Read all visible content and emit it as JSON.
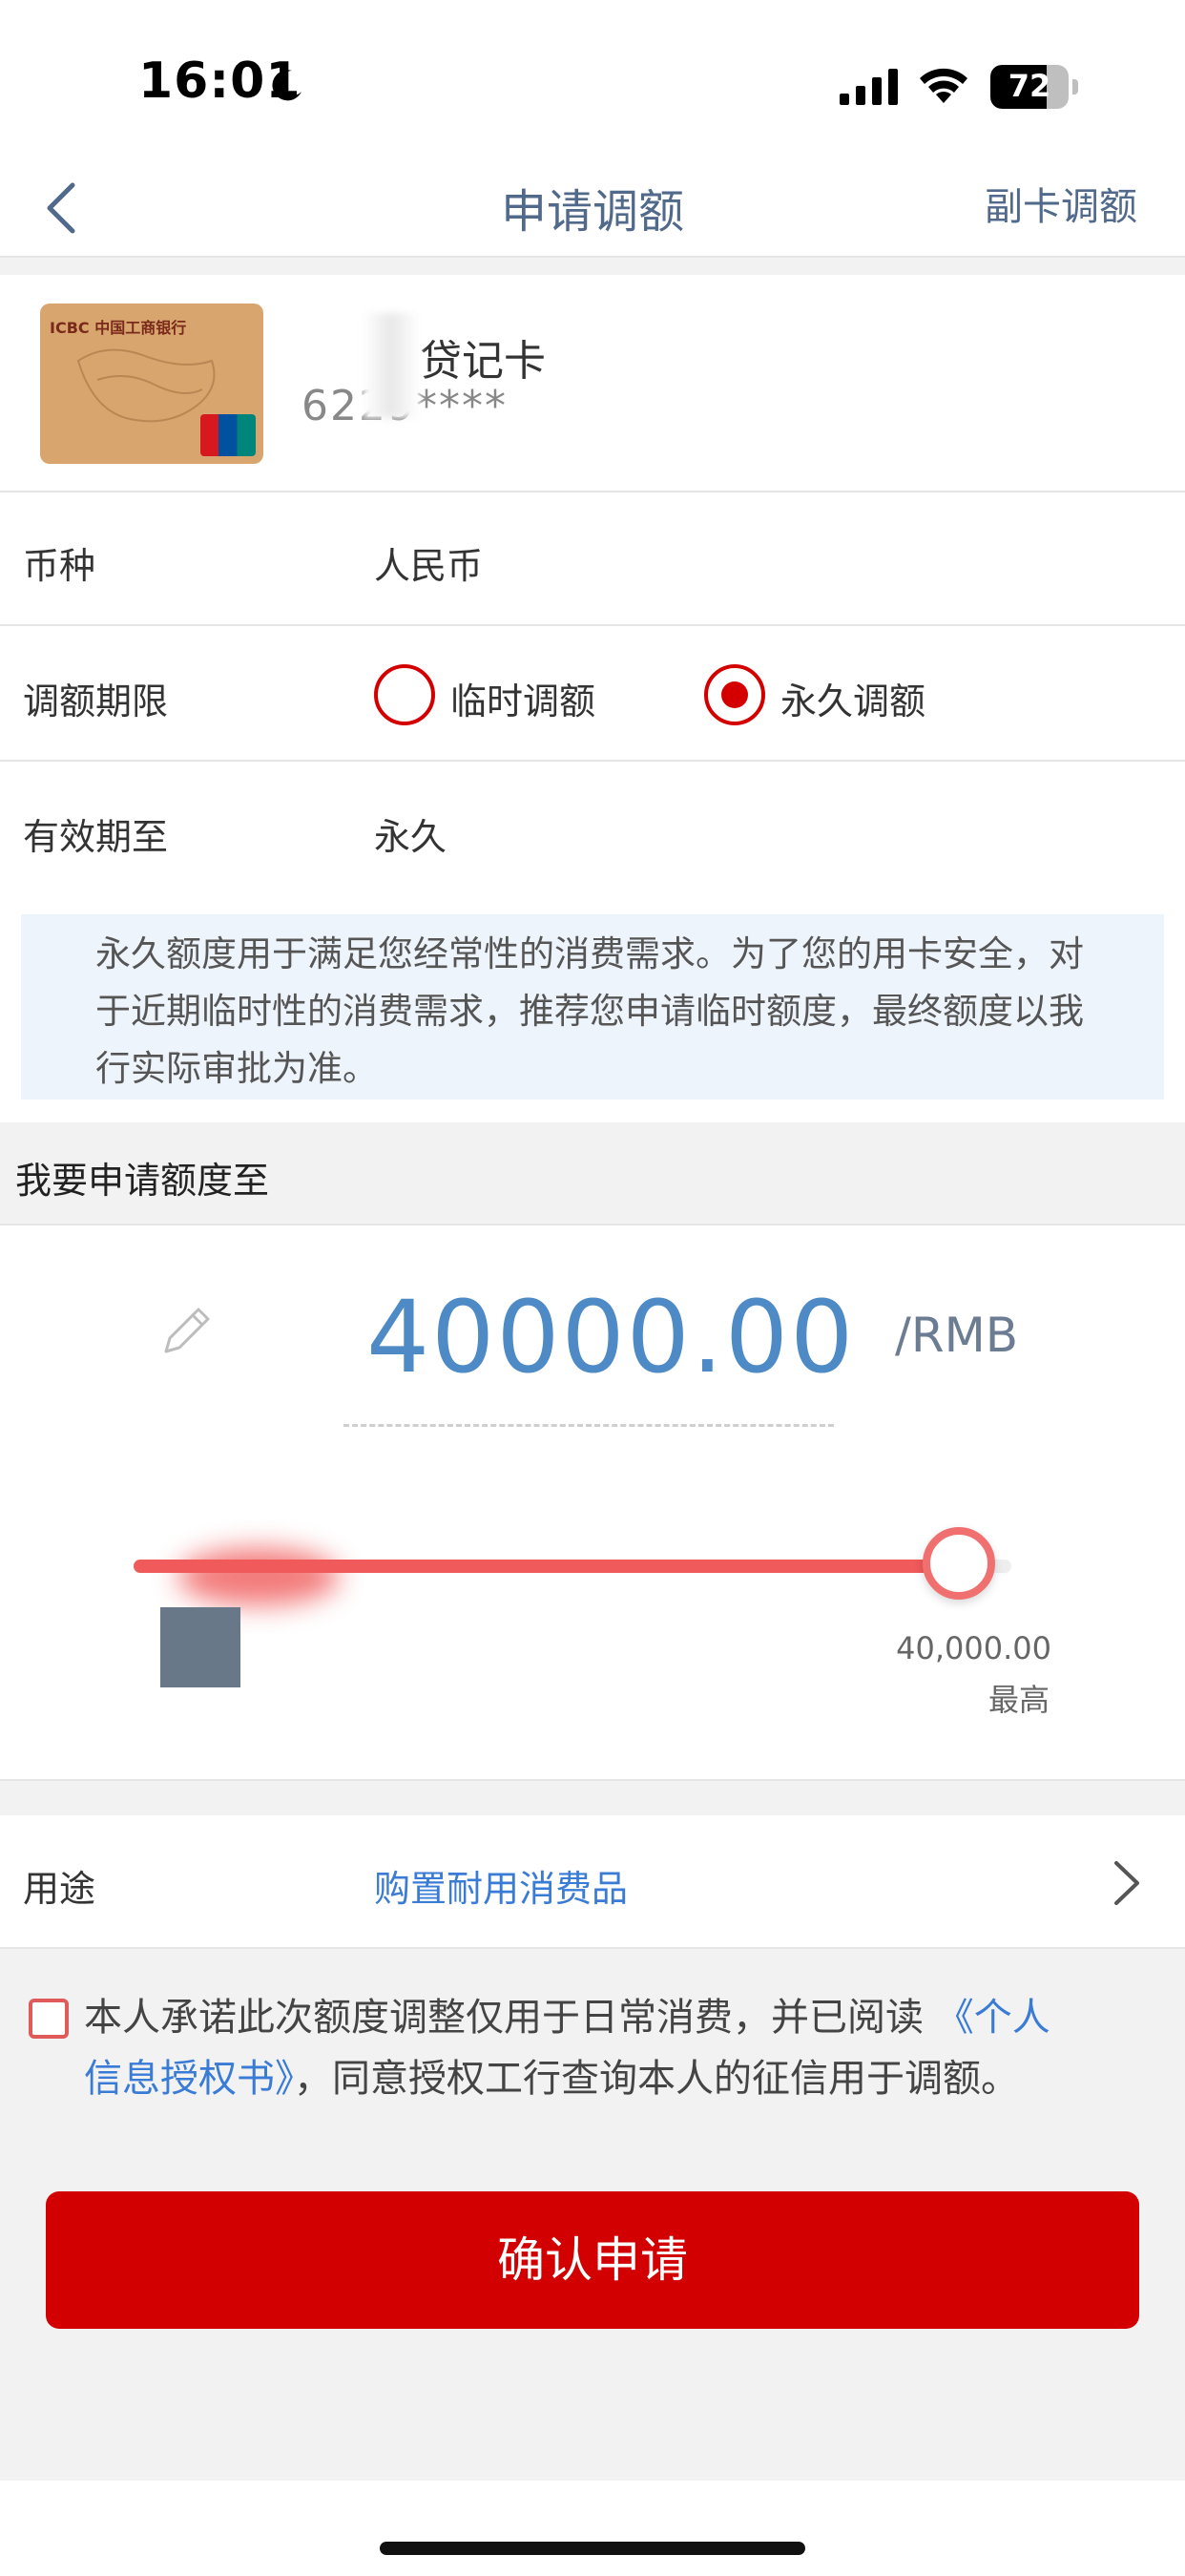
{
  "status_bar": {
    "time": "16:01",
    "battery_level": "72",
    "battery_fraction": 0.72
  },
  "nav": {
    "title": "申请调额",
    "right_action": "副卡调额"
  },
  "card": {
    "name": "贷记卡",
    "number": "6229****",
    "card_logo": "ICBC 中国工商银行"
  },
  "form": {
    "currency_label": "币种",
    "currency_value": "人民币",
    "period_label": "调额期限",
    "option_temporary": "临时调额",
    "option_permanent": "永久调额",
    "selected_option": "permanent",
    "valid_label": "有效期至",
    "valid_value": "永久"
  },
  "notice": {
    "text": "永久额度用于满足您经常性的消费需求。为了您的用卡安全，对于近期临时性的消费需求，推荐您申请临时额度，最终额度以我行实际审批为准。"
  },
  "amount": {
    "section_title": "我要申请额度至",
    "value": "40000.00",
    "unit": "/RMB",
    "slider_fraction": 1.0,
    "max_value": "40,000.00",
    "max_label": "最高"
  },
  "purpose": {
    "label": "用途",
    "value": "购置耐用消费品"
  },
  "agreement": {
    "text_before": "本人承诺此次额度调整仅用于日常消费，并已阅读",
    "link_text": "《个人信息授权书》",
    "text_after": "，同意授权工行查询本人的征信用于调额。",
    "link_part1": "《个人",
    "link_part2": "信息授权书》"
  },
  "confirm_button": "确认申请",
  "colors": {
    "accent_red": "#d20000",
    "link_blue": "#3a7bd5",
    "amount_blue": "#4d8ac6",
    "nav_text": "#51698a"
  }
}
